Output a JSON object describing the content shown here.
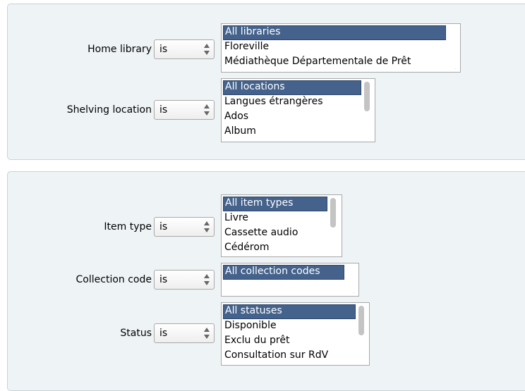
{
  "fieldset1": {
    "home_library": {
      "label": "Home library",
      "operator": "is",
      "options": [
        "All libraries",
        "Floreville",
        "Médiathèque Départementale de Prêt"
      ]
    },
    "shelving_location": {
      "label": "Shelving location",
      "operator": "is",
      "options": [
        "All locations",
        "Langues étrangères",
        "Ados",
        "Album"
      ]
    }
  },
  "fieldset2": {
    "item_type": {
      "label": "Item type",
      "operator": "is",
      "options": [
        "All item types",
        "Livre",
        "Cassette audio",
        "Cédérom"
      ]
    },
    "collection_code": {
      "label": "Collection code",
      "operator": "is",
      "options": [
        "All collection codes"
      ]
    },
    "status": {
      "label": "Status",
      "operator": "is",
      "options": [
        "All statuses",
        "Disponible",
        "Exclu du prêt",
        "Consultation sur RdV"
      ]
    }
  },
  "colors": {
    "fieldset_bg": "#eef3f6",
    "fieldset_border": "#c7d3db",
    "selected_option_bg": "#44628c"
  }
}
